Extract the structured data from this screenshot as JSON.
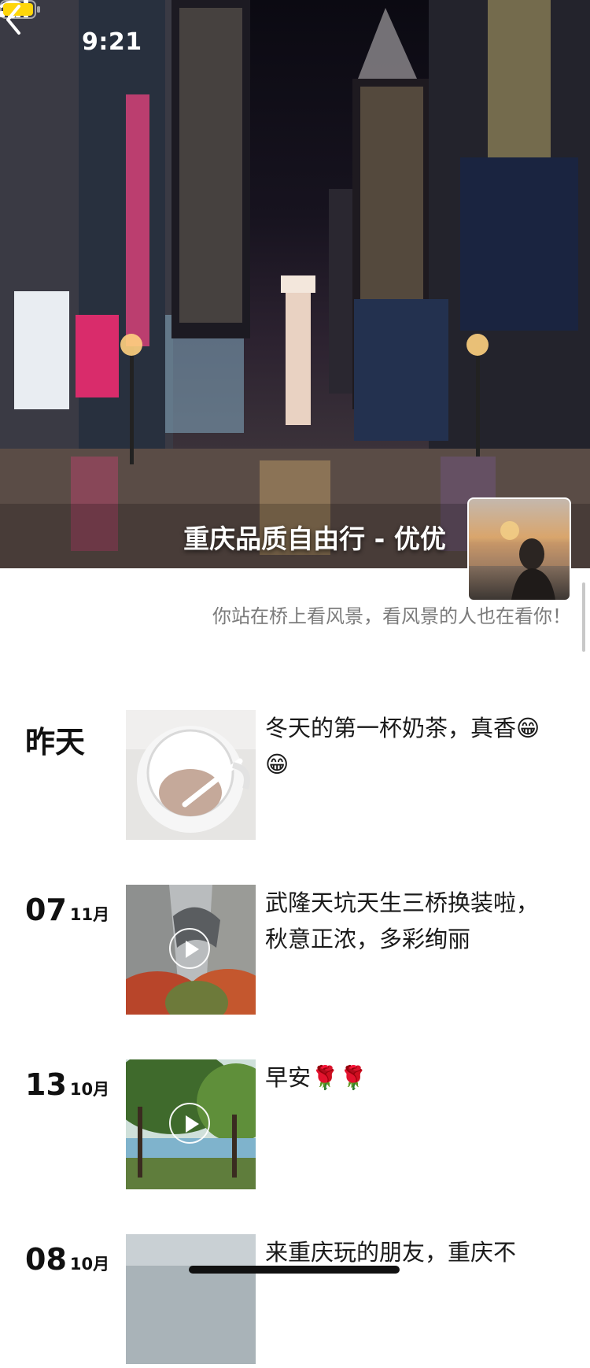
{
  "status_bar": {
    "time": "9:21"
  },
  "cover": {
    "title": "重庆品质自由行 - 优优"
  },
  "profile": {
    "signature": "你站在桥上看风景，看风景的人也在看你！"
  },
  "posts": [
    {
      "date_label": "昨天",
      "text": "冬天的第一杯奶茶，真香😁😁",
      "media": "photo"
    },
    {
      "day": "07",
      "month": "11月",
      "text": "武隆天坑天生三桥换装啦，秋意正浓，多彩绚丽",
      "media": "video"
    },
    {
      "day": "13",
      "month": "10月",
      "text": "早安🌹🌹",
      "media": "video"
    },
    {
      "day": "08",
      "month": "10月",
      "text": "来重庆玩的朋友，重庆不",
      "media": "photo"
    }
  ],
  "icons": [
    "back-icon",
    "signal-icon",
    "wifi-icon",
    "battery-icon",
    "play-icon"
  ],
  "colors": {
    "battery": "#ffd60a",
    "signature": "#7b7b7b",
    "background": "#ffffff"
  }
}
